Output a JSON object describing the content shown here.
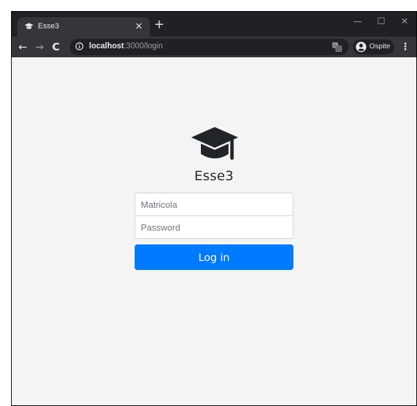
{
  "browser": {
    "tab_title": "Esse3",
    "tab_close": "×",
    "new_tab": "+",
    "window_controls": {
      "minimize": "—",
      "maximize": "☐",
      "close": "✕"
    },
    "nav": {
      "back": "←",
      "forward": "→",
      "reload": "C"
    },
    "url_host": "localhost",
    "url_path": ":3000/login",
    "profile_label": "Ospite",
    "menu": "⋮"
  },
  "page": {
    "app_title": "Esse3",
    "logo_icon": "graduation-cap-icon",
    "form": {
      "matricola_placeholder": "Matricola",
      "password_placeholder": "Password",
      "login_label": "Log in"
    }
  },
  "colors": {
    "primary": "#007bff",
    "page_bg": "#f4f4f4",
    "chrome_dark": "#202124",
    "chrome_toolbar": "#35363a"
  }
}
